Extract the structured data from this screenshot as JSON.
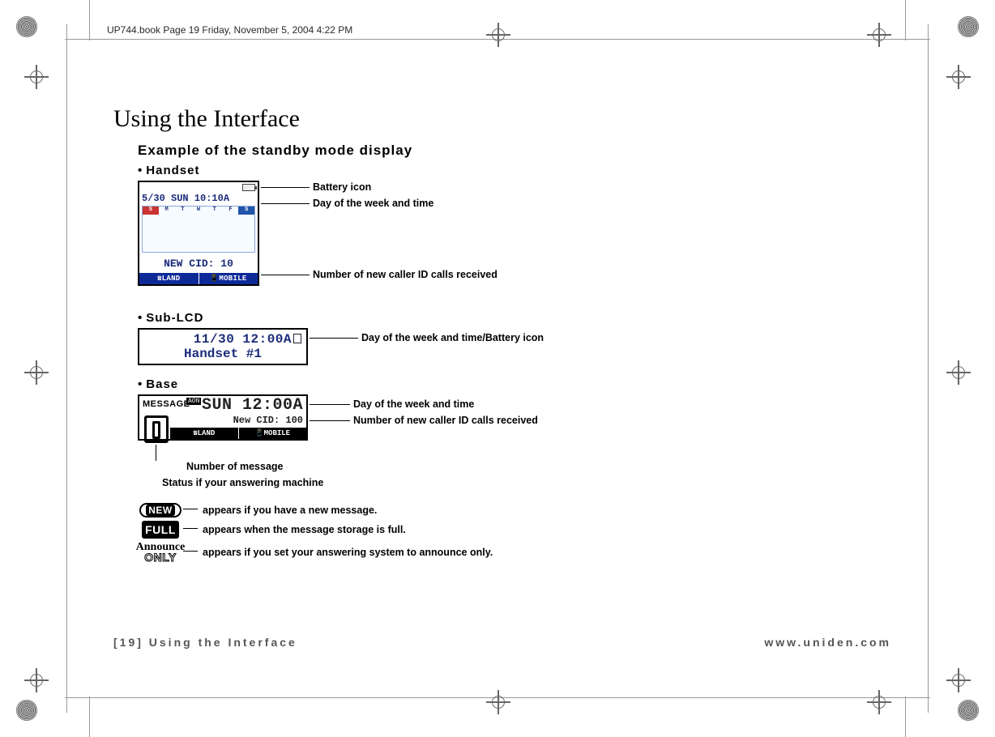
{
  "header": {
    "running": "UP744.book  Page 19  Friday, November 5, 2004  4:22 PM"
  },
  "title": "Using the Interface",
  "section": "Example of the standby mode display",
  "handset": {
    "heading": "Handset",
    "date_time": "5/30 SUN 10:10A",
    "cid": "NEW CID: 10",
    "foot_left": "☎LAND",
    "foot_right": "📱MOBILE",
    "days": [
      "S",
      "M",
      "T",
      "W",
      "T",
      "F",
      "S"
    ],
    "callouts": {
      "battery": "Battery icon",
      "daytime": "Day of the week and time",
      "cid": "Number of new caller ID calls received"
    }
  },
  "sublcd": {
    "heading": "Sub-LCD",
    "line1": "11/30 12:00A",
    "line2": "Handset #1",
    "callout": "Day of the week and time/Battery icon"
  },
  "base": {
    "heading": "Base",
    "msg": "MESSAGE",
    "aon": "AON",
    "time": "SUN 12:00A",
    "cid": "New CID: 100",
    "foot_left": "☎LAND",
    "foot_right": "📱MOBILE",
    "callouts": {
      "daytime": "Day of the week and time",
      "cid": "Number of new caller ID calls received",
      "below1": "Number of message",
      "below2": "Status if your answering machine"
    }
  },
  "legend": {
    "new_label": "NEW",
    "new_text": "appears if you have a new message.",
    "full_label": "FULL",
    "full_text": "appears when the message storage is full.",
    "announce_top": "Announce",
    "announce_bot": "ONLY",
    "announce_text": "appears if you set your answering system to announce only."
  },
  "footer": {
    "left": "[19] Using the Interface",
    "right": "www.uniden.com"
  }
}
